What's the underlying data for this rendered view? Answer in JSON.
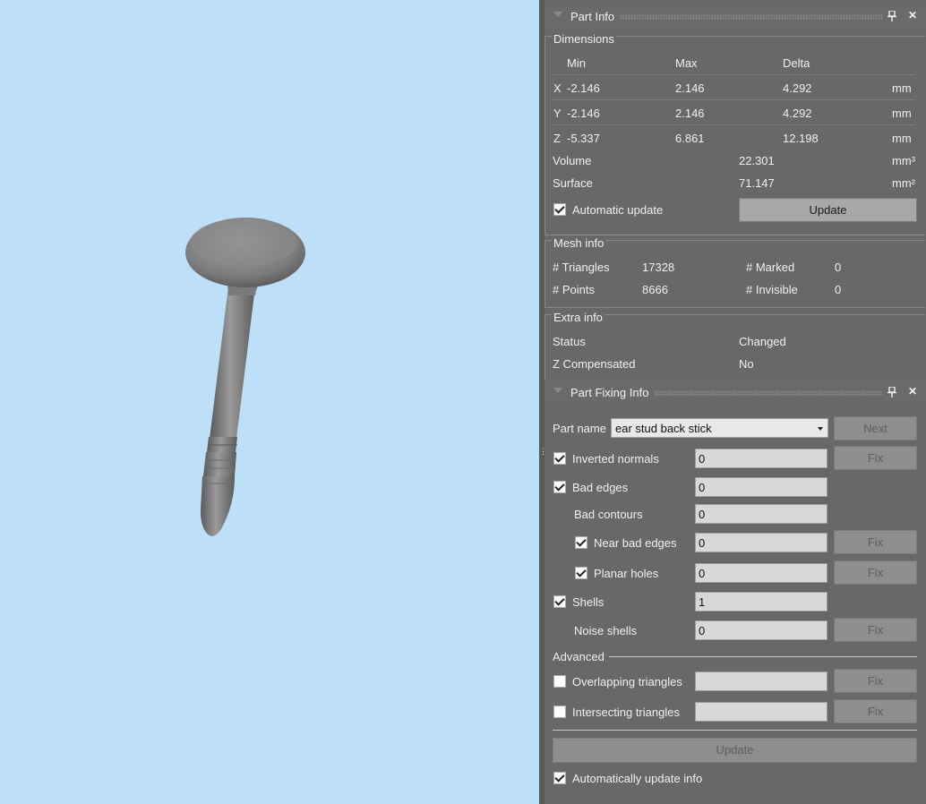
{
  "part_info": {
    "title": "Part Info",
    "dimensions": {
      "title": "Dimensions",
      "headers": [
        "Min",
        "Max",
        "Delta"
      ],
      "rows": [
        {
          "axis": "X",
          "min": "-2.146",
          "max": "2.146",
          "delta": "4.292",
          "unit": "mm"
        },
        {
          "axis": "Y",
          "min": "-2.146",
          "max": "2.146",
          "delta": "4.292",
          "unit": "mm"
        },
        {
          "axis": "Z",
          "min": "-5.337",
          "max": "6.861",
          "delta": "12.198",
          "unit": "mm"
        }
      ],
      "volume_label": "Volume",
      "volume_value": "22.301",
      "volume_unit": "mm³",
      "surface_label": "Surface",
      "surface_value": "71.147",
      "surface_unit": "mm²",
      "auto_update_label": "Automatic update",
      "auto_update_checked": true,
      "update_button": "Update"
    },
    "mesh_info": {
      "title": "Mesh info",
      "triangles_label": "# Triangles",
      "triangles_value": "17328",
      "points_label": "# Points",
      "points_value": "8666",
      "marked_label": "# Marked",
      "marked_value": "0",
      "invisible_label": "# Invisible",
      "invisible_value": "0"
    },
    "extra_info": {
      "title": "Extra info",
      "status_label": "Status",
      "status_value": "Changed",
      "zcomp_label": "Z Compensated",
      "zcomp_value": "No"
    }
  },
  "part_fixing": {
    "title": "Part Fixing Info",
    "part_name_label": "Part name",
    "part_name_value": "ear stud back stick",
    "next_button": "Next",
    "fix_label": "Fix",
    "inverted_normals": {
      "label": "Inverted normals",
      "checked": true,
      "value": "0"
    },
    "bad_edges": {
      "label": "Bad edges",
      "checked": true,
      "value": "0"
    },
    "bad_contours": {
      "label": "Bad contours",
      "value": "0"
    },
    "near_bad_edges": {
      "label": "Near bad edges",
      "checked": true,
      "value": "0"
    },
    "planar_holes": {
      "label": "Planar holes",
      "checked": true,
      "value": "0"
    },
    "shells": {
      "label": "Shells",
      "checked": true,
      "value": "1"
    },
    "noise_shells": {
      "label": "Noise shells",
      "value": "0"
    },
    "advanced_label": "Advanced",
    "overlapping": {
      "label": "Overlapping triangles",
      "checked": false,
      "value": ""
    },
    "intersecting": {
      "label": "Intersecting triangles",
      "checked": false,
      "value": ""
    },
    "update_button": "Update",
    "auto_update_info": {
      "label": "Automatically update info",
      "checked": true
    }
  },
  "colors": {
    "viewport_bg": "#bddff8",
    "panel_bg": "#686868",
    "model_gray": "#8a8a8a"
  }
}
